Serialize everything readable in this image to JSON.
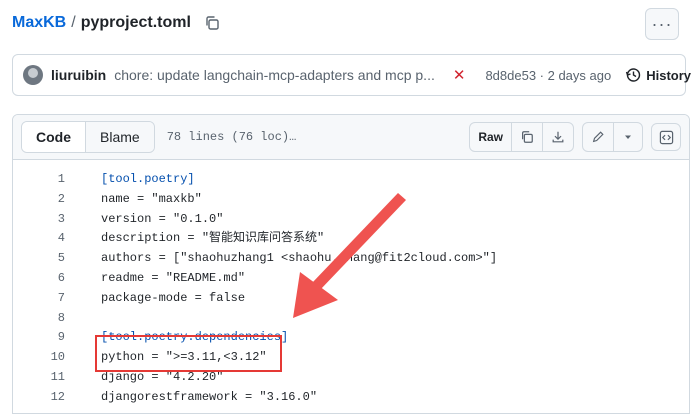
{
  "breadcrumb": {
    "repo": "MaxKB",
    "separator": "/",
    "file": "pyproject.toml"
  },
  "commit": {
    "author": "liuruibin",
    "message": "chore: update langchain-mcp-adapters and mcp p...",
    "sha_date": "8d8de53 · 2 days ago",
    "history_label": "History",
    "status_icon": "x-icon",
    "status_color": "#d1242f"
  },
  "file_header": {
    "tab_code": "Code",
    "tab_blame": "Blame",
    "loc": "78 lines (76 loc)…",
    "raw_label": "Raw"
  },
  "code_lines": [
    {
      "n": "1",
      "text": "[tool.poetry]"
    },
    {
      "n": "2",
      "text": "name = \"maxkb\""
    },
    {
      "n": "3",
      "text": "version = \"0.1.0\""
    },
    {
      "n": "4",
      "text": "description = \"智能知识库问答系统\""
    },
    {
      "n": "5",
      "text": "authors = [\"shaohuzhang1 <shaohu.zhang@fit2cloud.com>\"]"
    },
    {
      "n": "6",
      "text": "readme = \"README.md\""
    },
    {
      "n": "7",
      "text": "package-mode = false"
    },
    {
      "n": "8",
      "text": ""
    },
    {
      "n": "9",
      "text": "[tool.poetry.dependencies]"
    },
    {
      "n": "10",
      "text": "python = \">=3.11,<3.12\""
    },
    {
      "n": "11",
      "text": "django = \"4.2.20\""
    },
    {
      "n": "12",
      "text": "djangorestframework = \"3.16.0\""
    }
  ],
  "colors": {
    "accent": "#0969da",
    "annotation": "#e53935"
  }
}
